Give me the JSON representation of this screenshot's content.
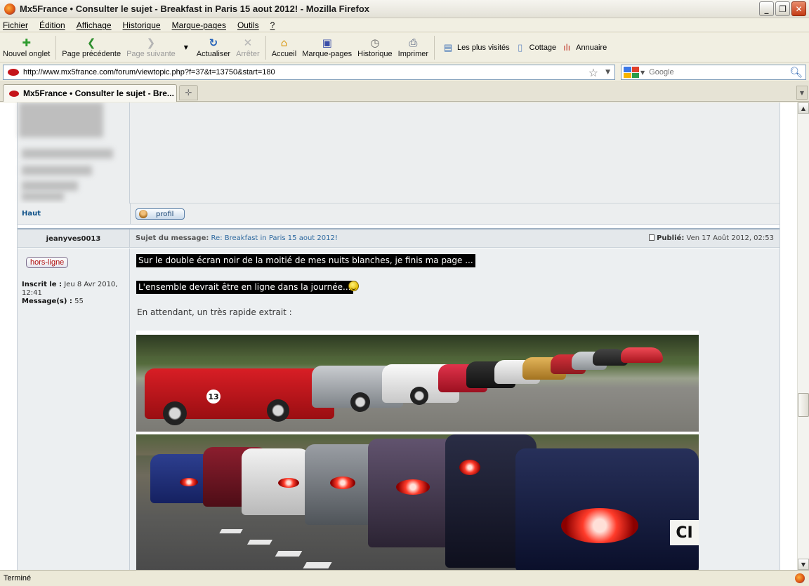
{
  "window": {
    "title": "Mx5France • Consulter le sujet - Breakfast in Paris 15 aout 2012! - Mozilla Firefox"
  },
  "menubar": {
    "items": [
      "Fichier",
      "Édition",
      "Affichage",
      "Historique",
      "Marque-pages",
      "Outils",
      "?"
    ]
  },
  "toolbar": {
    "new_tab": "Nouvel onglet",
    "back": "Page précédente",
    "forward": "Page suivante",
    "reload": "Actualiser",
    "stop": "Arrêter",
    "home": "Accueil",
    "bookmarks": "Marque-pages",
    "history": "Historique",
    "print": "Imprimer",
    "bookmark_links": [
      "Les plus visités",
      "Cottage",
      "Annuaire"
    ]
  },
  "urlbar": {
    "url": "http://www.mx5france.com/forum/viewtopic.php?f=37&t=13750&start=180",
    "search_placeholder": "Google"
  },
  "tabs": [
    {
      "label": "Mx5France • Consulter le sujet - Bre...",
      "active": true
    }
  ],
  "forum": {
    "prev_post": {
      "top_link": "Haut",
      "profile_button": "profil"
    },
    "post": {
      "author": "jeanyves0013",
      "status_badge": "hors-ligne",
      "registered_label": "Inscrit le :",
      "registered_value": "Jeu 8 Avr 2010, 12:41",
      "messages_label": "Message(s) :",
      "messages_value": "55",
      "subject_label": "Sujet du message:",
      "subject_value": "Re: Breakfast in Paris 15 aout 2012!",
      "published_label": "Publié:",
      "published_value": "Ven 17 Août 2012, 02:53",
      "lines": [
        "Sur le double écran noir de la moitié de mes nuits blanches, je finis ma page ...",
        "L'ensemble devrait être en ligne dans la journée...",
        "En attendant, un très rapide extrait :"
      ],
      "photo_car_number": "13",
      "photo_plate_text": "CI"
    }
  },
  "statusbar": {
    "text": "Terminé"
  },
  "colors": {
    "link_blue": "#105289",
    "subject_blue": "#2f6aa0",
    "offline_red": "#b21212",
    "highlight_bg": "#000000"
  }
}
